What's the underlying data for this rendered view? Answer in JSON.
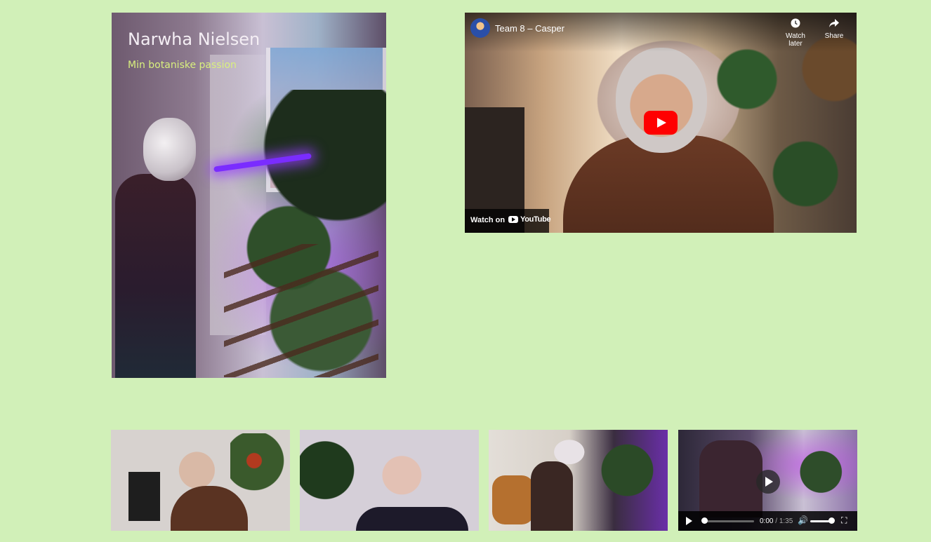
{
  "hero": {
    "title": "Narwha Nielsen",
    "subtitle": "Min botaniske passion"
  },
  "youtube": {
    "video_title": "Team 8 – Casper",
    "watch_later_label": "Watch later",
    "share_label": "Share",
    "watch_on_label": "Watch on",
    "youtube_wordmark": "YouTube",
    "icons": {
      "watch_later": "clock-icon",
      "share": "share-arrow-icon",
      "play": "youtube-play-icon"
    },
    "colors": {
      "play_button": "#ff0000"
    }
  },
  "thumbnails": [
    {
      "name": "thumbnail-1"
    },
    {
      "name": "thumbnail-2"
    },
    {
      "name": "thumbnail-3"
    },
    {
      "name": "thumbnail-4"
    }
  ],
  "video_player": {
    "current_time": "0:00",
    "separator": "/",
    "duration": "1:35",
    "progress": 0.0,
    "volume": 1.0,
    "icons": {
      "play": "play-icon",
      "volume": "speaker-icon",
      "fullscreen": "fullscreen-icon"
    }
  },
  "colors": {
    "page_background": "#d1f0b8",
    "hero_title": "#f4eef4",
    "hero_subtitle": "#d9f07e"
  }
}
